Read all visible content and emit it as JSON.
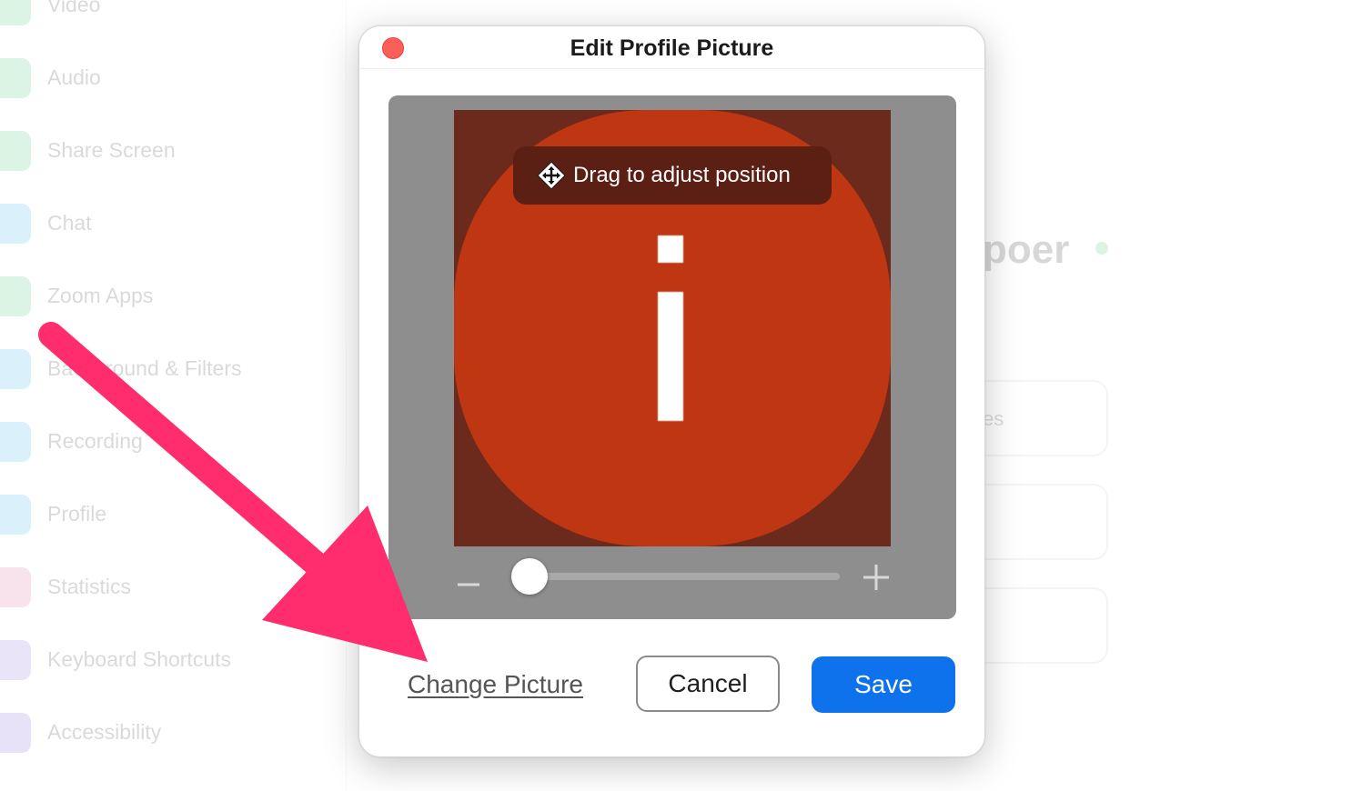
{
  "background": {
    "sidebar": {
      "items": [
        {
          "label": "Video",
          "icon": "video-icon",
          "color": "#2fbf55"
        },
        {
          "label": "Audio",
          "icon": "headphones-icon",
          "color": "#2fbf55"
        },
        {
          "label": "Share Screen",
          "icon": "share-screen-icon",
          "color": "#2fbf55"
        },
        {
          "label": "Chat",
          "icon": "chat-icon",
          "color": "#23a7e8"
        },
        {
          "label": "Zoom Apps",
          "icon": "zoom-apps-icon",
          "color": "#2fbf55"
        },
        {
          "label": "Background & Filters",
          "icon": "background-icon",
          "color": "#23a7e8"
        },
        {
          "label": "Recording",
          "icon": "recording-icon",
          "color": "#23a7e8"
        },
        {
          "label": "Profile",
          "icon": "profile-icon",
          "color": "#23a7e8"
        },
        {
          "label": "Statistics",
          "icon": "statistics-icon",
          "color": "#d94f8a"
        },
        {
          "label": "Keyboard Shortcuts",
          "icon": "keyboard-icon",
          "color": "#7b5cd6"
        },
        {
          "label": "Accessibility",
          "icon": "accessibility-icon",
          "color": "#6d4fd6"
        }
      ]
    },
    "profile_name_partial": "poer",
    "status_color": "#2fbf55",
    "box_label_partial": "es"
  },
  "dialog": {
    "title": "Edit Profile Picture",
    "drag_hint": "Drag to adjust position",
    "move_icon": "move-arrows-icon",
    "zoom": {
      "minus_icon": "minus-icon",
      "plus_icon": "plus-icon",
      "level": 0.02
    },
    "change_picture_label": "Change Picture",
    "cancel_label": "Cancel",
    "save_label": "Save",
    "colors": {
      "close": "#fc5f57",
      "save": "#0e72ed",
      "avatar": "#be3612",
      "avatar_backdrop": "#6c2a1d",
      "arrow": "#ff2d6e"
    }
  },
  "annotation": {
    "arrow_icon": "pink-arrow-icon"
  }
}
